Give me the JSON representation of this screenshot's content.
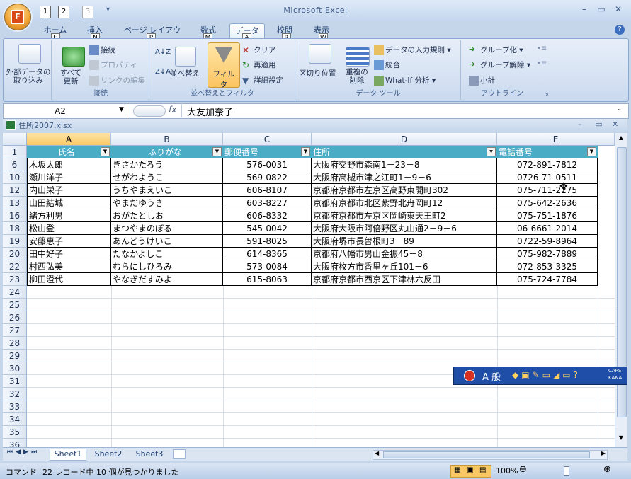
{
  "window": {
    "title": "Microsoft Excel",
    "qat": [
      "1",
      "2",
      "3"
    ],
    "office_keytip": "F"
  },
  "ribbon": {
    "tabs": [
      {
        "label": "ホーム",
        "key": "H"
      },
      {
        "label": "挿入",
        "key": "N"
      },
      {
        "label": "ページ レイアウト",
        "key": "P"
      },
      {
        "label": "数式",
        "key": "M"
      },
      {
        "label": "データ",
        "key": "A"
      },
      {
        "label": "校閲",
        "key": "R"
      },
      {
        "label": "表示",
        "key": "W"
      }
    ],
    "active_tab": "データ",
    "groups": {
      "external": {
        "label": "外部データの取り込み"
      },
      "connections": {
        "label": "接続",
        "refresh_all": "すべて更新",
        "connections": "接続",
        "properties": "プロパティ",
        "edit_links": "リンクの編集"
      },
      "sort_filter": {
        "label": "並べ替えとフィルタ",
        "sort": "並べ替え",
        "filter": "フィルタ",
        "clear": "クリア",
        "reapply": "再適用",
        "advanced": "詳細設定"
      },
      "data_tools": {
        "label": "データ ツール",
        "text_to_columns": "区切り位置",
        "remove_duplicates": "重複の削除",
        "validation": "データの入力規則",
        "consolidate": "統合",
        "whatif": "What-If 分析"
      },
      "outline": {
        "label": "アウトライン",
        "group": "グループ化",
        "ungroup": "グループ解除",
        "subtotal": "小計"
      }
    }
  },
  "formula_bar": {
    "name_box": "A2",
    "fx": "fx",
    "content": "大友加奈子"
  },
  "workbook": {
    "title": "住所2007.xlsx"
  },
  "sheet": {
    "columns": [
      "A",
      "B",
      "C",
      "D",
      "E"
    ],
    "header_row": {
      "row": "1",
      "cells": [
        "氏名",
        "ふりがな",
        "郵便番号",
        "住所",
        "電話番号"
      ]
    },
    "rows": [
      {
        "row": "6",
        "cells": [
          "木坂太郎",
          "きさかたろう",
          "576-0031",
          "大阪府交野市森南1－23－8",
          "072-891-7812"
        ]
      },
      {
        "row": "10",
        "cells": [
          "瀬川洋子",
          "せがわようこ",
          "569-0822",
          "大阪府高槻市津之江町1－9－6",
          "0726-71-0511"
        ]
      },
      {
        "row": "12",
        "cells": [
          "内山栄子",
          "うちやまえいこ",
          "606-8107",
          "京都府京都市左京区高野東開町302",
          "075-711-2275"
        ]
      },
      {
        "row": "13",
        "cells": [
          "山田結城",
          "やまだゆうき",
          "603-8227",
          "京都府京都市北区紫野北舟岡町12",
          "075-642-2636"
        ]
      },
      {
        "row": "16",
        "cells": [
          "緒方利男",
          "おがたとしお",
          "606-8332",
          "京都府京都市左京区岡崎東天王町2",
          "075-751-1876"
        ]
      },
      {
        "row": "18",
        "cells": [
          "松山登",
          "まつやまのぼる",
          "545-0042",
          "大阪府大阪市阿倍野区丸山通2－9－6",
          "06-6661-2014"
        ]
      },
      {
        "row": "19",
        "cells": [
          "安藤恵子",
          "あんどうけいこ",
          "591-8025",
          "大阪府堺市長曽根町3－89",
          "0722-59-8964"
        ]
      },
      {
        "row": "20",
        "cells": [
          "田中好子",
          "たなかよしこ",
          "614-8365",
          "京都府八幡市男山金振45－8",
          "075-982-7889"
        ]
      },
      {
        "row": "22",
        "cells": [
          "村西弘美",
          "むらにしひろみ",
          "573-0084",
          "大阪府枚方市香里ヶ丘101－6",
          "072-853-3325"
        ]
      },
      {
        "row": "23",
        "cells": [
          "柳田澄代",
          "やなぎだすみよ",
          "615-8063",
          "京都府京都市西京区下津林六反田",
          "075-724-7784"
        ]
      }
    ],
    "empty_rows": [
      "24",
      "25",
      "26",
      "27",
      "28",
      "29",
      "30",
      "31",
      "32",
      "33",
      "34",
      "35",
      "36"
    ]
  },
  "sheet_tabs": [
    "Sheet1",
    "Sheet2",
    "Sheet3"
  ],
  "status": {
    "mode": "コマンド",
    "message": "22 レコード中 10 個が見つかりました",
    "zoom": "100%"
  },
  "ime": {
    "mode": "A 般",
    "caps": "CAPS",
    "kana": "KANA"
  },
  "colors": {
    "table_header": "#4bacc6",
    "selected_col": "#f9c865",
    "ribbon_bg": "#d7e3f3"
  }
}
